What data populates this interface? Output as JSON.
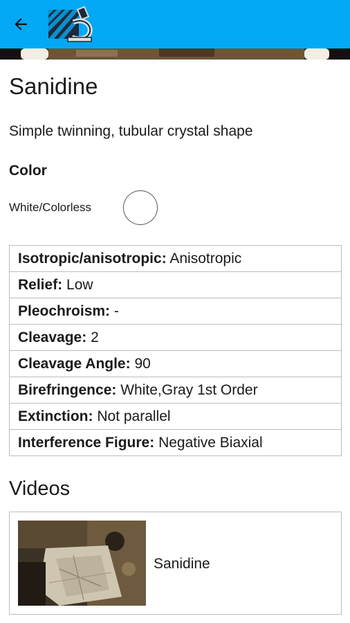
{
  "header": {
    "back_icon": "arrow-left-icon",
    "logo_icon": "microscope-logo-icon",
    "accent_color": "#03a9f4"
  },
  "mineral": {
    "name": "Sanidine",
    "description": "Simple twinning, tubular crystal shape",
    "color_heading": "Color",
    "color_name": "White/Colorless",
    "swatch_color": "#ffffff"
  },
  "properties": [
    {
      "label": "Isotropic/anisotropic:",
      "value": "Anisotropic"
    },
    {
      "label": "Relief:",
      "value": "Low"
    },
    {
      "label": "Pleochroism:",
      "value": "-"
    },
    {
      "label": "Cleavage:",
      "value": "2"
    },
    {
      "label": "Cleavage Angle:",
      "value": "90"
    },
    {
      "label": "Birefringence:",
      "value": "White,Gray 1st Order"
    },
    {
      "label": "Extinction:",
      "value": "Not parallel"
    },
    {
      "label": "Interference Figure:",
      "value": "Negative Biaxial"
    }
  ],
  "videos": {
    "heading": "Videos",
    "items": [
      {
        "title": "Sanidine"
      }
    ]
  }
}
